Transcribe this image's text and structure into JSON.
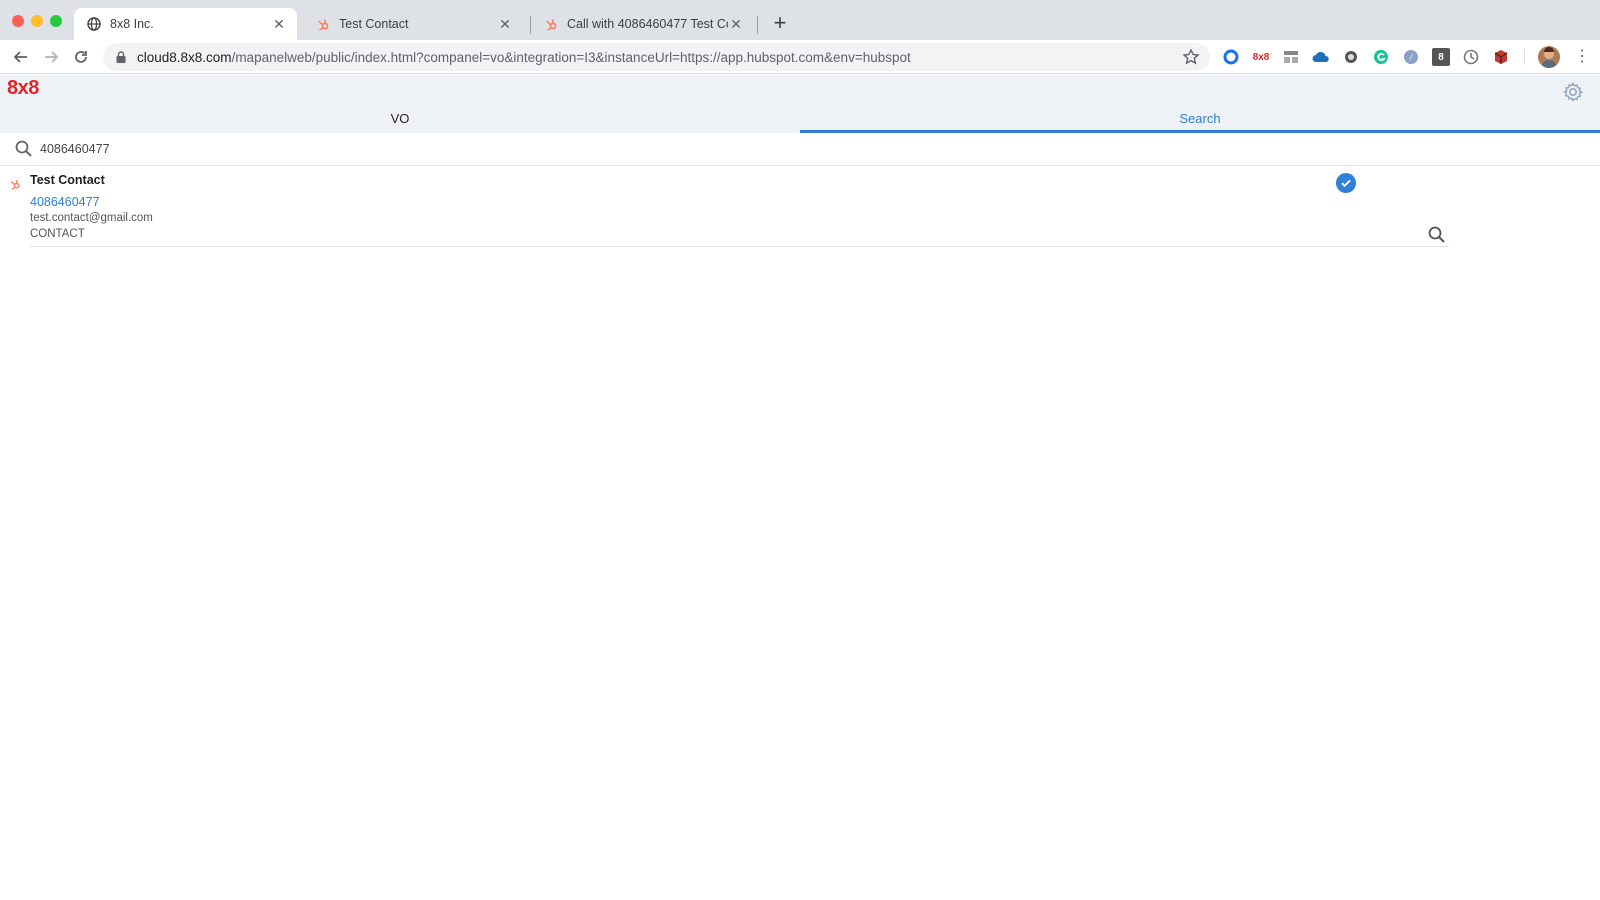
{
  "browser": {
    "tabs": [
      {
        "title": "8x8 Inc.",
        "favicon": "globe-icon",
        "active": true
      },
      {
        "title": "Test Contact",
        "favicon": "hubspot-icon",
        "active": false
      },
      {
        "title": "Call with 4086460477 Test Co",
        "favicon": "hubspot-icon",
        "active": false
      }
    ],
    "url_host": "cloud8.8x8.com",
    "url_path": "/mapanelweb/public/index.html?companel=vo&integration=I3&instanceUrl=https://app.hubspot.com&env=hubspot",
    "extensions": [
      "circle-icon",
      "8x8-extension-icon",
      "grid-extension-icon",
      "cloud-icon",
      "record-icon",
      "grammarly-icon",
      "compass-icon",
      "bookmark-8-icon",
      "clock-icon",
      "cube-icon"
    ],
    "ext_8x8_label": "8x8",
    "ext_8_label": "8"
  },
  "app": {
    "logo": "8x8",
    "tabs": [
      "VO",
      "Search"
    ],
    "active_tab": "Search",
    "search": {
      "value": "4086460477",
      "placeholder": ""
    },
    "results": [
      {
        "name": "Test Contact",
        "phone": "4086460477",
        "email": "test.contact@gmail.com",
        "type": "CONTACT",
        "selected": true
      }
    ]
  },
  "colors": {
    "brand": "#e32526",
    "accent": "#2d7fd3",
    "hubspot": "#ff7a59"
  }
}
